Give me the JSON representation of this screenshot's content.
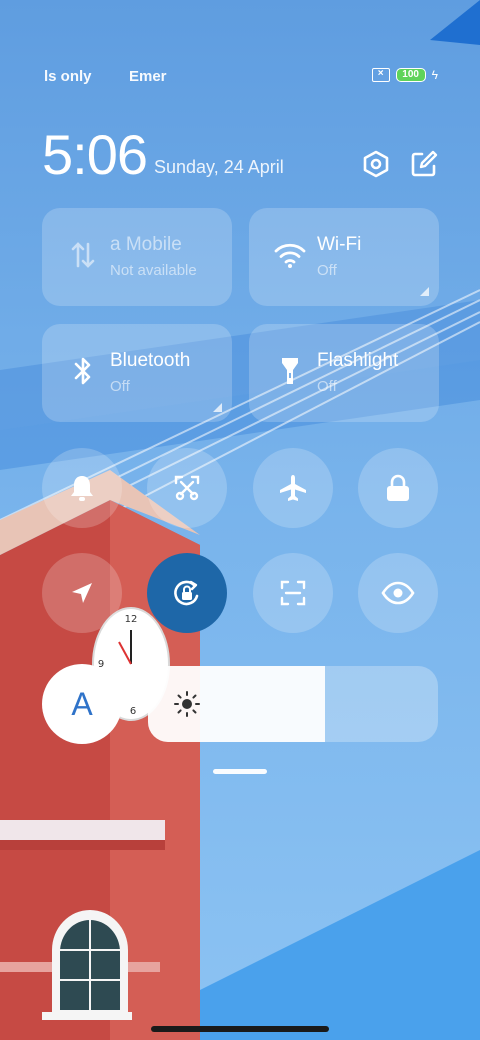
{
  "status_bar": {
    "carrier_1": "ls only",
    "carrier_2": "Emer",
    "battery_level": "100",
    "icons": [
      "sim-x-icon",
      "battery-icon",
      "charging-bolt-icon"
    ]
  },
  "header": {
    "time": "5:06",
    "date": "Sunday, 24 April",
    "icons": [
      "settings-hexagon-icon",
      "edit-icon"
    ]
  },
  "tiles": [
    {
      "label": "a       Mobile",
      "status": "Not available",
      "icon": "mobile-data-icon"
    },
    {
      "label": "Wi-Fi",
      "status": "Off",
      "icon": "wifi-icon"
    },
    {
      "label": "Bluetooth",
      "status": "Off",
      "icon": "bluetooth-icon"
    },
    {
      "label": "Flashlight",
      "status": "Off",
      "icon": "flashlight-icon"
    }
  ],
  "toggles_row_1": [
    "bell-icon",
    "screenshot-scissors-icon",
    "airplane-icon",
    "lock-icon"
  ],
  "toggles_row_2": [
    "location-icon",
    "rotation-lock-icon",
    "scan-icon",
    "reading-mode-eye-icon"
  ],
  "brightness": {
    "auto_label": "A",
    "level": 0.61,
    "icon": "sun-icon"
  },
  "colors": {
    "active_toggle": "#1e67a8",
    "auto_text": "#2f73c9",
    "battery_green": "#5fd35a"
  }
}
